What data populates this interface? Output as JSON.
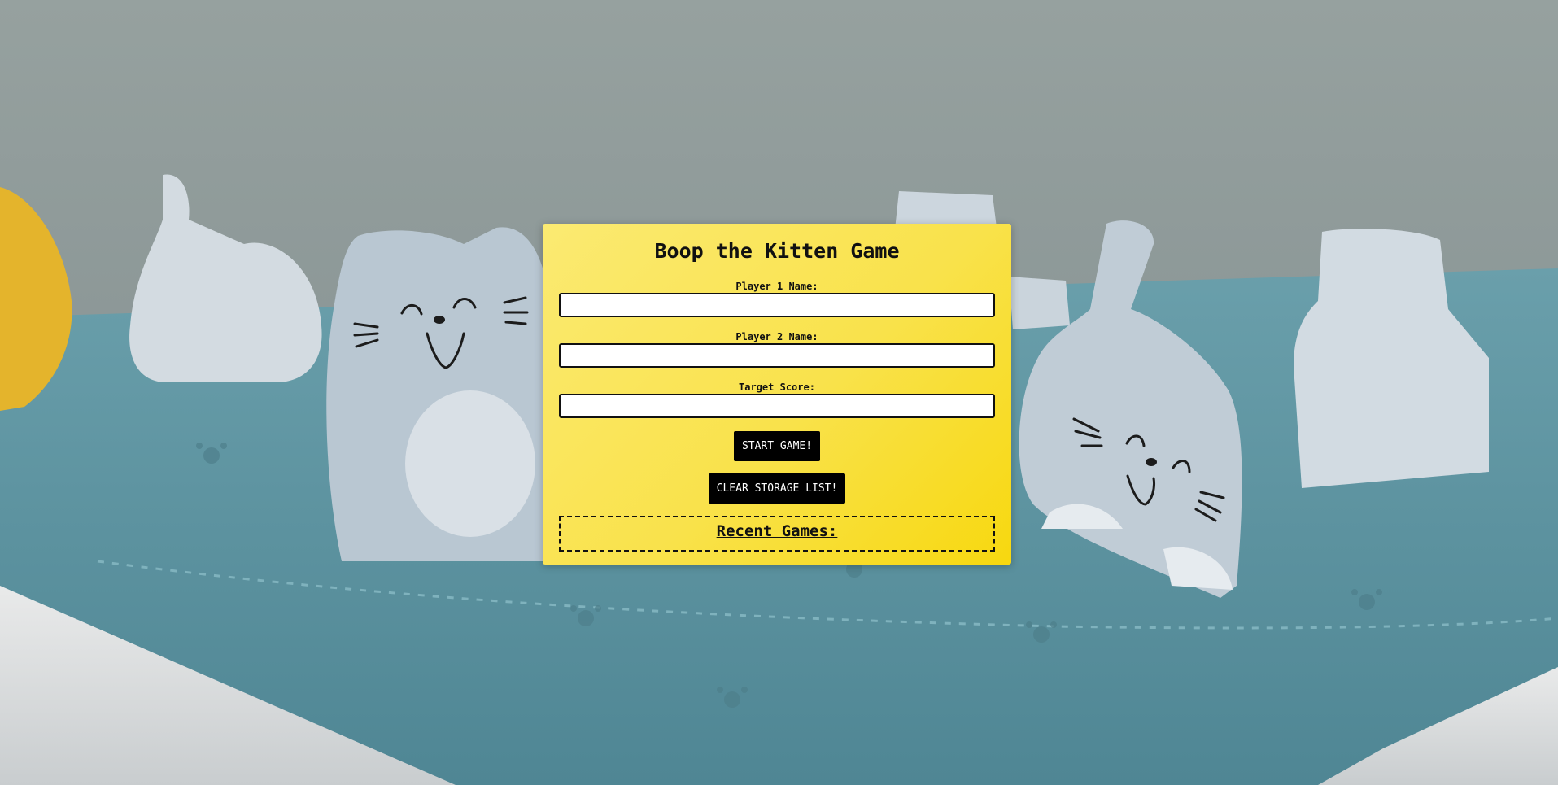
{
  "form": {
    "title": "Boop the Kitten Game",
    "player1_label": "Player 1 Name:",
    "player1_value": "",
    "player2_label": "Player 2 Name:",
    "player2_value": "",
    "target_label": "Target Score:",
    "target_value": "",
    "start_button": "START GAME!",
    "clear_button": "CLEAR STORAGE LIST!"
  },
  "recent": {
    "title": "Recent Games:"
  },
  "colors": {
    "panel_accent": "#f9e24b",
    "button_bg": "#000000",
    "button_text": "#ffffff"
  }
}
